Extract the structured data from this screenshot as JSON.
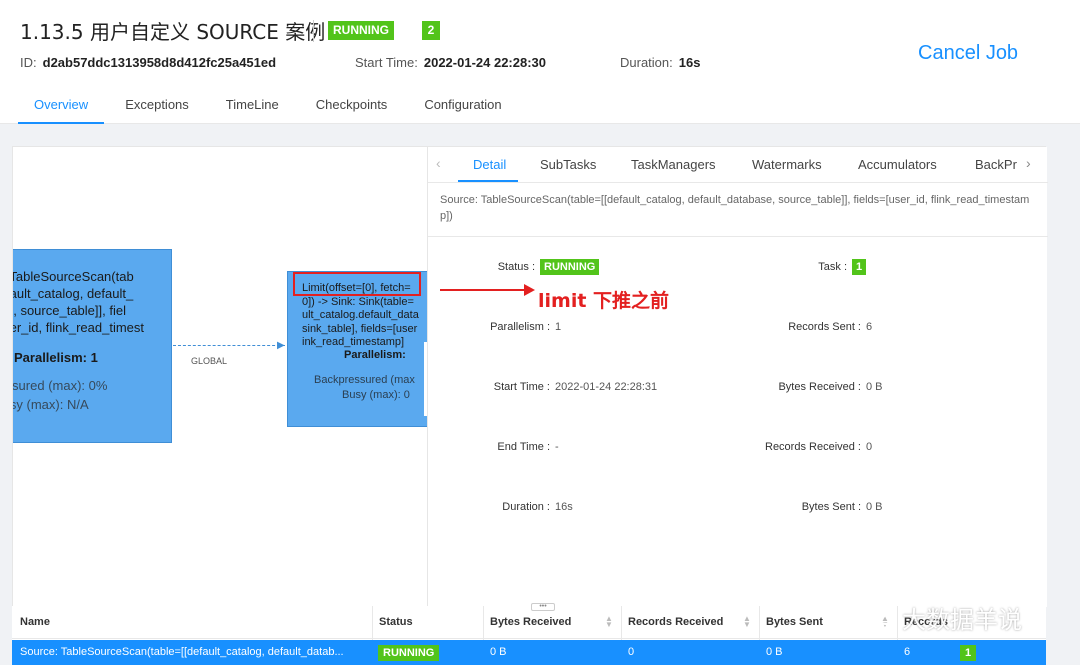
{
  "job": {
    "title": "1.13.5 用户自定义 SOURCE 案例",
    "status": "RUNNING",
    "task_count": "2",
    "id_label": "ID:",
    "id": "d2ab57ddc1313958d8d412fc25a451ed",
    "start_label": "Start Time:",
    "start_time": "2022-01-24 22:28:30",
    "duration_label": "Duration:",
    "duration": "16s",
    "cancel_label": "Cancel Job"
  },
  "nav": {
    "tabs": [
      {
        "label": "Overview",
        "active": true
      },
      {
        "label": "Exceptions"
      },
      {
        "label": "TimeLine"
      },
      {
        "label": "Checkpoints"
      },
      {
        "label": "Configuration"
      }
    ]
  },
  "graph": {
    "node1": {
      "text": " TableSourceScan(tab\nfault_catalog, default_\ne, source_table]], fiel\n er_id, flink_read_timest",
      "parallelism": "Parallelism: 1",
      "backpressure": "ressured (max): 0%",
      "busy": "Busy (max): N/A"
    },
    "node2": {
      "text": "Limit(offset=[0], fetch=\n0]) -> Sink: Sink(table=\nult_catalog.default_data\nsink_table], fields=[user\nink_read_timestamp]",
      "parallelism": "Parallelism:",
      "backpressure": "Backpressured (max",
      "busy": "Busy (max): 0"
    },
    "edge_label": "GLOBAL",
    "annotation": "limit 下推之前",
    "arrow_color": "#e32020"
  },
  "detail": {
    "tabs": [
      "Detail",
      "SubTasks",
      "TaskManagers",
      "Watermarks",
      "Accumulators",
      "BackPr"
    ],
    "description": "Source: TableSourceScan(table=[[default_catalog, default_database, source_table]], fields=[user_id, flink_read_timestamp])",
    "fields": {
      "status_label": "Status :",
      "status": "RUNNING",
      "task_label": "Task :",
      "task": "1",
      "parallelism_label": "Parallelism :",
      "parallelism": "1",
      "records_sent_label": "Records Sent :",
      "records_sent": "6",
      "start_time_label": "Start Time :",
      "start_time": "2022-01-24 22:28:31",
      "bytes_received_label": "Bytes Received :",
      "bytes_received": "0 B",
      "end_time_label": "End Time :",
      "end_time": "-",
      "records_received_label": "Records Received :",
      "records_received": "0",
      "duration_label": "Duration :",
      "duration": "16s",
      "bytes_sent_label": "Bytes Sent :",
      "bytes_sent": "0 B"
    }
  },
  "table": {
    "headers": [
      "Name",
      "Status",
      "Bytes Received",
      "Records Received",
      "Bytes Sent",
      "Records"
    ],
    "row": {
      "name": "Source: TableSourceScan(table=[[default_catalog, default_datab...",
      "status": "RUNNING",
      "bytes_received": "0 B",
      "records_received": "0",
      "bytes_sent": "0 B",
      "records_sent": "6",
      "tasks": "1"
    }
  },
  "watermark": "大数据羊说",
  "colors": {
    "accent": "#1890ff",
    "running": "#52c41a",
    "node": "#5aa9ef",
    "annotation": "#e32020"
  }
}
